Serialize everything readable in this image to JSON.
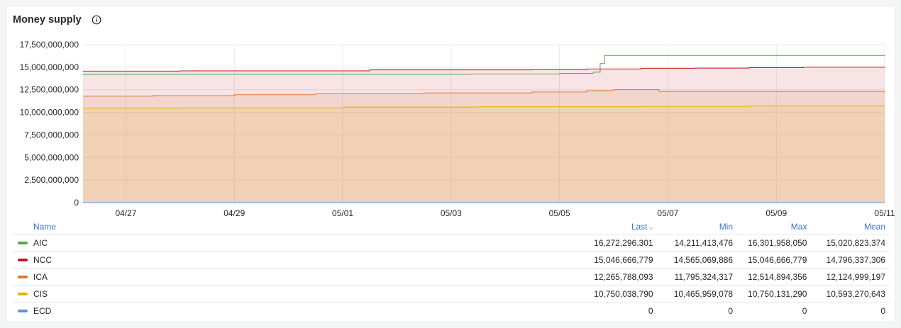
{
  "panel": {
    "title": "Money supply",
    "info_icon": "info-circle-icon"
  },
  "chart_data": {
    "type": "area",
    "title": "Money supply",
    "xlabel": "",
    "ylabel": "",
    "ylim": [
      0,
      17500000000
    ],
    "yticks": [
      0,
      2500000000,
      5000000000,
      7500000000,
      10000000000,
      12500000000,
      15000000000,
      17500000000
    ],
    "ytick_labels": [
      "0",
      "2,500,000,000",
      "5,000,000,000",
      "7,500,000,000",
      "10,000,000,000",
      "12,500,000,000",
      "15,000,000,000",
      "17,500,000,000"
    ],
    "xlim": [
      "04/26 17:00",
      "05/11 12:00"
    ],
    "xticks": [
      "04/27",
      "04/29",
      "05/01",
      "05/03",
      "05/05",
      "05/07",
      "05/09",
      "05/11"
    ],
    "grid": true,
    "stacked": false,
    "series": [
      {
        "name": "AIC",
        "color": "#56a64b",
        "fill": false,
        "points": [
          [
            "04/26 17:00",
            14200000000
          ],
          [
            "04/28 12:00",
            14211413476
          ],
          [
            "05/03 20:00",
            14240000000
          ],
          [
            "05/05 12:00",
            14320000000
          ],
          [
            "05/06 03:00",
            14450000000
          ],
          [
            "05/06 06:00",
            15400000000
          ],
          [
            "05/06 08:00",
            16301958050
          ],
          [
            "05/11 12:00",
            16272296301
          ]
        ]
      },
      {
        "name": "NCC",
        "color": "#c4162a",
        "fill": true,
        "points": [
          [
            "04/26 17:00",
            14565069886
          ],
          [
            "04/28 12:00",
            14600000000
          ],
          [
            "05/02 00:00",
            14700000000
          ],
          [
            "05/05 00:00",
            14720000000
          ],
          [
            "05/06 00:00",
            14800000000
          ],
          [
            "05/07 00:00",
            14880000000
          ],
          [
            "05/08 00:00",
            14900000000
          ],
          [
            "05/09 00:00",
            14950000000
          ],
          [
            "05/10 00:00",
            15000000000
          ],
          [
            "05/11 12:00",
            15046666779
          ]
        ]
      },
      {
        "name": "ICA",
        "color": "#e0752d",
        "fill": true,
        "points": [
          [
            "04/26 17:00",
            11795324317
          ],
          [
            "04/28 00:00",
            11850000000
          ],
          [
            "04/29 12:00",
            11950000000
          ],
          [
            "05/01 00:00",
            12050000000
          ],
          [
            "05/03 00:00",
            12150000000
          ],
          [
            "05/05 00:00",
            12250000000
          ],
          [
            "05/06 00:00",
            12400000000
          ],
          [
            "05/06 12:00",
            12514894356
          ],
          [
            "05/07 08:00",
            12300000000
          ],
          [
            "05/11 12:00",
            12265788093
          ]
        ]
      },
      {
        "name": "CIS",
        "color": "#e0b400",
        "fill": true,
        "points": [
          [
            "04/26 17:00",
            10465959078
          ],
          [
            "04/28 12:00",
            10500000000
          ],
          [
            "05/01 12:00",
            10580000000
          ],
          [
            "05/04 00:00",
            10620000000
          ],
          [
            "05/07 00:00",
            10650000000
          ],
          [
            "05/09 00:00",
            10700000000
          ],
          [
            "05/11 12:00",
            10750038790
          ]
        ]
      },
      {
        "name": "ECD",
        "color": "#5794f2",
        "fill": false,
        "points": [
          [
            "04/26 17:00",
            0
          ],
          [
            "05/11 12:00",
            0
          ]
        ]
      }
    ]
  },
  "legend": {
    "headers": {
      "name": "Name",
      "last": "Last",
      "min": "Min",
      "max": "Max",
      "mean": "Mean"
    },
    "sort_indicator": "chevron-down-icon",
    "rows": [
      {
        "name": "AIC",
        "color": "#56a64b",
        "last": "16,272,296,301",
        "min": "14,211,413,476",
        "max": "16,301,958,050",
        "mean": "15,020,823,374"
      },
      {
        "name": "NCC",
        "color": "#c4162a",
        "last": "15,046,666,779",
        "min": "14,565,069,886",
        "max": "15,046,666,779",
        "mean": "14,796,337,306"
      },
      {
        "name": "ICA",
        "color": "#e0752d",
        "last": "12,265,788,093",
        "min": "11,795,324,317",
        "max": "12,514,894,356",
        "mean": "12,124,999,197"
      },
      {
        "name": "CIS",
        "color": "#e0b400",
        "last": "10,750,038,790",
        "min": "10,465,959,078",
        "max": "10,750,131,290",
        "mean": "10,593,270,643"
      },
      {
        "name": "ECD",
        "color": "#5794f2",
        "last": "0",
        "min": "0",
        "max": "0",
        "mean": "0"
      }
    ]
  }
}
